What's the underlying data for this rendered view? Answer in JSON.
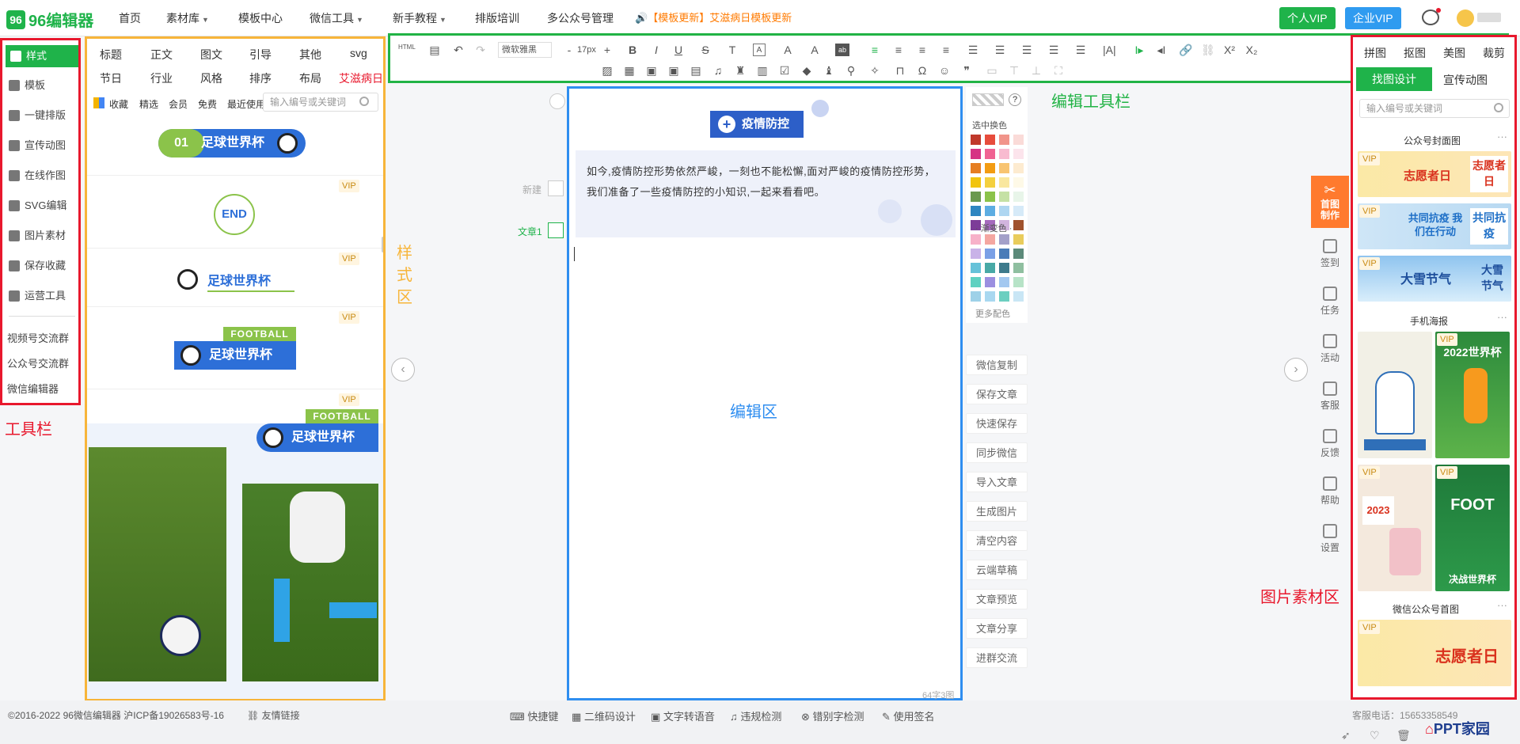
{
  "header": {
    "logo_text": "96编辑器",
    "nav": [
      "首页",
      "素材库",
      "模板中心",
      "微信工具",
      "新手教程",
      "排版培训",
      "多公众号管理"
    ],
    "notice": "【模板更新】艾滋病日模板更新",
    "btn_personal_vip": "个人VIP",
    "btn_enterprise_vip": "企业VIP"
  },
  "colors": {
    "green": "#1fb34a",
    "blue": "#2d6fd8",
    "red": "#e8182d",
    "orange": "#ff7a00"
  },
  "left_tools": {
    "items": [
      "样式",
      "模板",
      "一键排版",
      "宣传动图",
      "在线作图",
      "SVG编辑",
      "图片素材",
      "保存收藏",
      "运营工具"
    ],
    "groups": [
      "视频号交流群",
      "公众号交流群",
      "微信编辑器"
    ]
  },
  "style_panel": {
    "tabs_row1": [
      "标题",
      "正文",
      "图文",
      "引导",
      "其他",
      "svg"
    ],
    "tabs_row2": [
      "节日",
      "行业",
      "风格",
      "排序",
      "布局",
      "艾滋病日"
    ],
    "subtabs": [
      "收藏",
      "精选",
      "会员",
      "免费",
      "最近使用"
    ],
    "search_placeholder": "输入编号或关键词",
    "samples": {
      "num": "01",
      "title": "足球世界杯",
      "end": "END",
      "football": "FOOTBALL",
      "vip": "VIP"
    }
  },
  "toolbar": {
    "font": "微软雅黑",
    "size": "17px",
    "html": "HTML"
  },
  "editor": {
    "title": "疫情防控",
    "paragraph": "如今,疫情防控形势依然严峻，一刻也不能松懈,面对严峻的疫情防控形势，我们准备了一些疫情防控的小知识,一起来看看吧。",
    "new_label": "新建",
    "article_label": "文章1",
    "count": "64字3图"
  },
  "color_panel": {
    "selected_swap": "选中换色",
    "gradient": "· 渐变色 ·",
    "more": "更多配色",
    "swatches": [
      "#c0392b",
      "#e74c3c",
      "#f1948a",
      "#fadbd8",
      "#d63384",
      "#f06292",
      "#f8bbd0",
      "#fce4ec",
      "#e67e22",
      "#f39c12",
      "#f8c471",
      "#fdebd0",
      "#f1c40f",
      "#f4d03f",
      "#f9e79f",
      "#fef9e7",
      "#6a994e",
      "#8bc34a",
      "#c5e1a5",
      "#e8f5e9",
      "#2e86c1",
      "#5dade2",
      "#aed6f1",
      "#d6eaf8",
      "#7d3c98",
      "#a569bd",
      "#d2b4de",
      "#a0522d"
    ],
    "gradients": [
      "#f7b1c9",
      "#f4a7a1",
      "#a3a0c9",
      "#e9cc5c",
      "#c9b2e8",
      "#7aa0e6",
      "#4a7cb8",
      "#5c8a7a",
      "#66c2d9",
      "#48a9a6",
      "#3d7a8c",
      "#8fbfa0",
      "#5fd1c1",
      "#9b8fe0",
      "#a3c8f0",
      "#b7e3c7",
      "#9ed1e8",
      "#a9d8f0",
      "#6ccfc0",
      "#c9e6f5"
    ]
  },
  "actions": [
    "微信复制",
    "保存文章",
    "快速保存",
    "同步微信",
    "导入文章",
    "生成图片",
    "清空内容",
    "云端草稿",
    "文章预览",
    "文章分享",
    "进群交流"
  ],
  "side_icons": [
    "首图制作",
    "签到",
    "任务",
    "活动",
    "客服",
    "反馈",
    "帮助",
    "设置"
  ],
  "img_panel": {
    "tabs": [
      "拼图",
      "抠图",
      "美图",
      "裁剪"
    ],
    "subtab_active": "找图设计",
    "subtab2": "宣传动图",
    "search_placeholder": "输入编号或关键词",
    "sections": [
      "公众号封面图",
      "手机海报",
      "微信公众号首图"
    ],
    "thumbs": [
      {
        "text": "志愿者日",
        "tag": "VIP"
      },
      {
        "text": "共同抗疫 我们在行动",
        "tag": "VIP"
      },
      {
        "text": "大雪节气",
        "tag": "VIP"
      },
      {
        "text": "2022世界杯",
        "tag": "VIP"
      },
      {
        "text": "FOOT",
        "tag": "VIP"
      },
      {
        "text": "2023",
        "tag": "VIP"
      },
      {
        "text": "决战世界杯",
        "tag": ""
      },
      {
        "text": "志愿者日",
        "tag": "VIP"
      }
    ],
    "cover_right_1": "志愿者日",
    "cover_right_2": "共同抗疫",
    "cover_right_3": "大雪节气"
  },
  "annotations": {
    "toolbar_label": "工具栏",
    "style_label": "样式区",
    "edit_toolbar_label": "编辑工具栏",
    "edit_area_label": "编辑区",
    "img_area_label": "图片素材区"
  },
  "footer": {
    "copyright": "©2016-2022 96微信编辑器 沪ICP备19026583号-16",
    "friend_link": "友情链接",
    "items": [
      "快捷键",
      "二维码设计",
      "文字转语音",
      "违规检测",
      "错别字检测",
      "使用签名"
    ],
    "phone": "客服电话：15653358549",
    "watermark": "PPT家园"
  }
}
